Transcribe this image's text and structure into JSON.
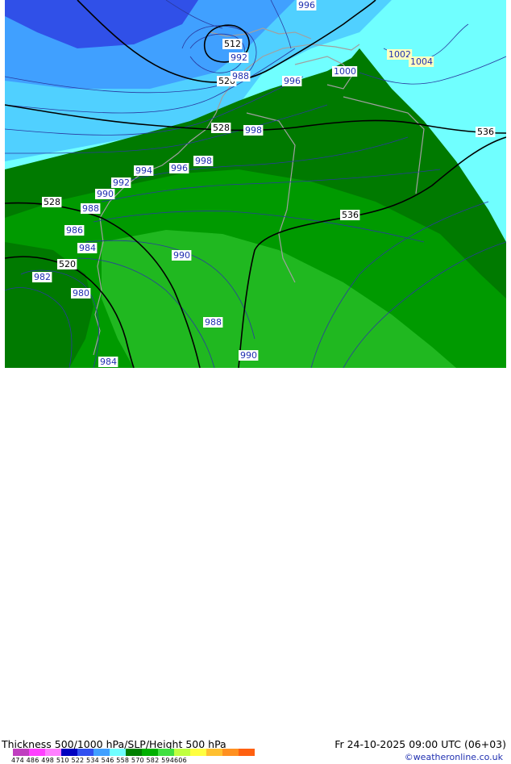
{
  "footer": {
    "title": "Thickness 500/1000 hPa/SLP/Height 500 hPa",
    "datetime": "Fr 24-10-2025 09:00 UTC (06+03)",
    "credit": "©weatheronline.co.uk",
    "legend_ticks": "474 486  498  510  522  534  546  558  570  582  594606"
  },
  "legend": {
    "colors": [
      "#c040c0",
      "#ff40ff",
      "#ff80ff",
      "#0000c0",
      "#3050f0",
      "#40a0ff",
      "#70ffff",
      "#008000",
      "#00b000",
      "#40e040",
      "#c0ff40",
      "#ffff40",
      "#ffc030",
      "#ff9020",
      "#ff6010"
    ]
  },
  "map": {
    "colors": {
      "deep_blue": "#3050e8",
      "blue": "#40a0ff",
      "light_blue": "#50d0ff",
      "cyan": "#70ffff",
      "dark_green": "#007a00",
      "green": "#009a00",
      "light_green": "#20b820",
      "coast": "#a0a0a0",
      "isobar": "#2a3aa0",
      "height_line": "#000000"
    },
    "height_labels": [
      {
        "text": "512",
        "kind": "height"
      },
      {
        "text": "520",
        "kind": "height"
      },
      {
        "text": "528",
        "kind": "height"
      },
      {
        "text": "528",
        "kind": "height"
      },
      {
        "text": "520",
        "kind": "height"
      },
      {
        "text": "536",
        "kind": "height"
      },
      {
        "text": "536",
        "kind": "height"
      }
    ],
    "isobar_labels": [
      {
        "text": "996"
      },
      {
        "text": "992"
      },
      {
        "text": "988"
      },
      {
        "text": "1000"
      },
      {
        "text": "996"
      },
      {
        "text": "1002"
      },
      {
        "text": "1004"
      },
      {
        "text": "998"
      },
      {
        "text": "998"
      },
      {
        "text": "996"
      },
      {
        "text": "994"
      },
      {
        "text": "992"
      },
      {
        "text": "990"
      },
      {
        "text": "988"
      },
      {
        "text": "986"
      },
      {
        "text": "984"
      },
      {
        "text": "982"
      },
      {
        "text": "980"
      },
      {
        "text": "990"
      },
      {
        "text": "988"
      },
      {
        "text": "990"
      },
      {
        "text": "984"
      }
    ]
  }
}
